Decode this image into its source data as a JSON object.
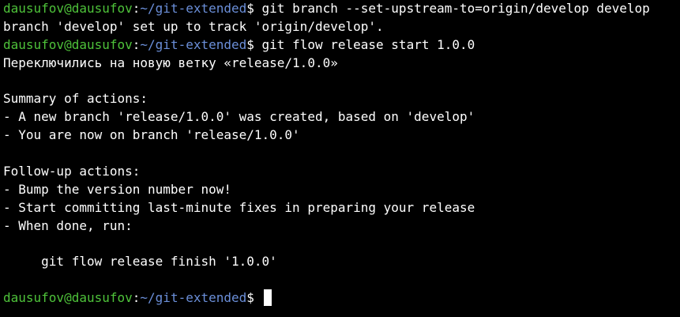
{
  "prompt": {
    "user_host": "dausufov@dausufov",
    "separator": ":",
    "path": "~/git-extended",
    "symbol": "$",
    "user_color": "#4ec23a",
    "path_color": "#6b8fd9"
  },
  "lines": {
    "l1_cmd": " git branch --set-upstream-to=origin/develop develop",
    "l2": "branch 'develop' set up to track 'origin/develop'.",
    "l3_cmd": " git flow release start 1.0.0",
    "l4": "Переключились на новую ветку «release/1.0.0»",
    "l5": "",
    "l6": "Summary of actions:",
    "l7": "- A new branch 'release/1.0.0' was created, based on 'develop'",
    "l8": "- You are now on branch 'release/1.0.0'",
    "l9": "",
    "l10": "Follow-up actions:",
    "l11": "- Bump the version number now!",
    "l12": "- Start committing last-minute fixes in preparing your release",
    "l13": "- When done, run:",
    "l14": "",
    "l15": "     git flow release finish '1.0.0'",
    "l16": ""
  },
  "background_color": "#000000",
  "text_color": "#ffffff"
}
